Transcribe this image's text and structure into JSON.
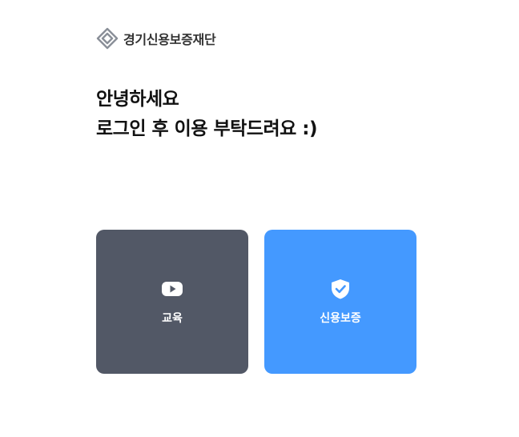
{
  "header": {
    "logo_text": "경기신용보증재단",
    "logo_icon": "diamond-logo-icon"
  },
  "greeting": {
    "line1": "안녕하세요",
    "line2": "로그인 후 이용 부탁드려요 :)"
  },
  "tiles": [
    {
      "label": "교육",
      "icon": "play-icon",
      "color": "#525866"
    },
    {
      "label": "신용보증",
      "icon": "shield-check-icon",
      "color": "#4499ff"
    }
  ]
}
